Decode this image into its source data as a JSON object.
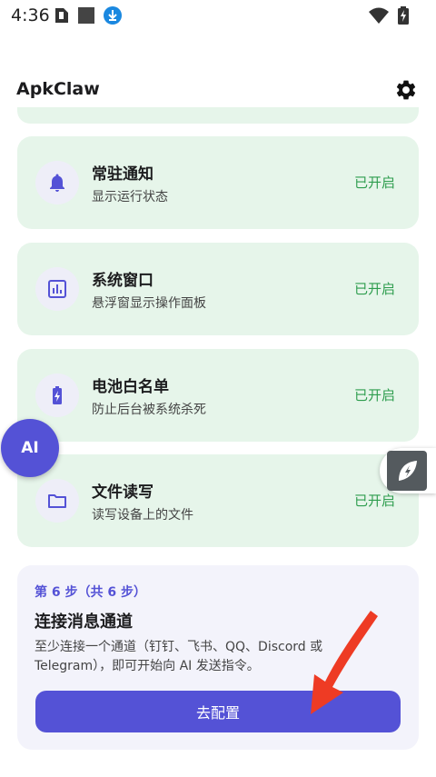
{
  "status_bar": {
    "time": "4:36",
    "icons": [
      "sim-icon",
      "square-icon",
      "download-icon",
      "wifi-icon",
      "battery-charging-icon"
    ]
  },
  "app": {
    "title": "ApkClaw",
    "settings_icon": "gear-icon"
  },
  "permissions": [
    {
      "icon": "bell-icon",
      "title": "常驻通知",
      "subtitle": "显示运行状态",
      "status": "已开启"
    },
    {
      "icon": "chart-icon",
      "title": "系统窗口",
      "subtitle": "悬浮窗显示操作面板",
      "status": "已开启"
    },
    {
      "icon": "battery-icon",
      "title": "电池白名单",
      "subtitle": "防止后台被系统杀死",
      "status": "已开启"
    },
    {
      "icon": "folder-icon",
      "title": "文件读写",
      "subtitle": "读写设备上的文件",
      "status": "已开启"
    }
  ],
  "ai_bubble": {
    "label": "AI"
  },
  "side_widget": {
    "icon": "leaf-bolt-icon"
  },
  "step": {
    "label": "第 6 步（共 6 步）",
    "title": "连接消息通道",
    "description": "至少连接一个通道（钉钉、飞书、QQ、Discord 或 Telegram），即可开始向 AI 发送指令。",
    "button_label": "去配置"
  },
  "colors": {
    "accent": "#5452d6",
    "card_green": "#e6f5ea",
    "status_green": "#2e9d4e",
    "arrow_red": "#ee3b24"
  }
}
